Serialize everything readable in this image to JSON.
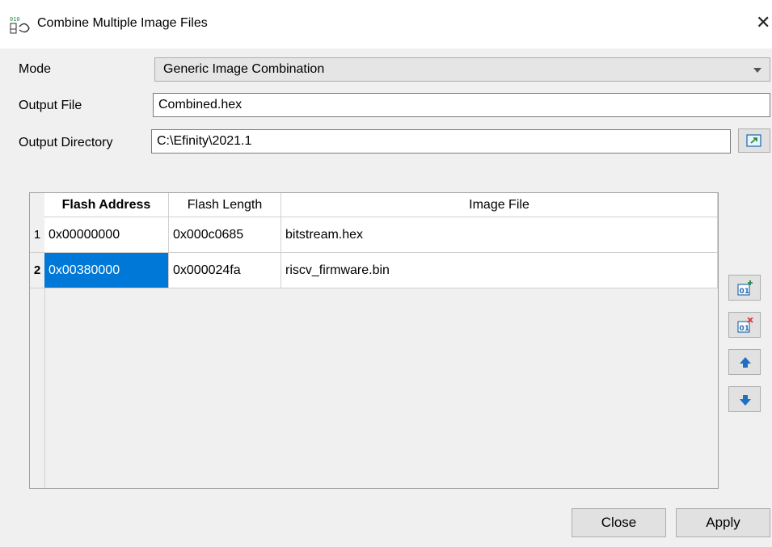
{
  "window": {
    "title": "Combine Multiple Image Files"
  },
  "form": {
    "mode_label": "Mode",
    "mode_value": "Generic Image Combination",
    "output_file_label": "Output File",
    "output_file_value": "Combined.hex",
    "output_dir_label": "Output Directory",
    "output_dir_value": "C:\\Efinity\\2021.1"
  },
  "table": {
    "headers": [
      "Flash Address",
      "Flash Length",
      "Image File"
    ],
    "rows": [
      {
        "num": "1",
        "address": "0x00000000",
        "length": "0x000c0685",
        "file": "bitstream.hex"
      },
      {
        "num": "2",
        "address": "0x00380000",
        "length": "0x000024fa",
        "file": "riscv_firmware.bin"
      }
    ],
    "selected_row": 2
  },
  "side_icons": [
    "add-image-icon",
    "remove-image-icon",
    "move-up-icon",
    "move-down-icon"
  ],
  "buttons": {
    "close": "Close",
    "apply": "Apply"
  },
  "colors": {
    "selection": "#0078d7",
    "window_bg": "#f0f0f0"
  }
}
